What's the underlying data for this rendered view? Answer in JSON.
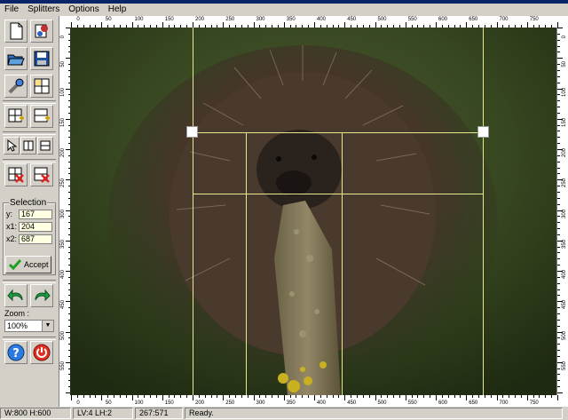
{
  "menu": {
    "file": "File",
    "splitters": "Splitters",
    "options": "Options",
    "help": "Help"
  },
  "selection": {
    "title": "Selection",
    "y_label": "y:",
    "y_value": "167",
    "x1_label": "x1:",
    "x1_value": "204",
    "x2_label": "x2:",
    "x2_value": "687",
    "accept_label": "Accept"
  },
  "zoom": {
    "label": "Zoom :",
    "value": "100%"
  },
  "ruler": {
    "top_marks": [
      "0",
      "50",
      "100",
      "150",
      "200",
      "250",
      "300",
      "350",
      "400",
      "450",
      "500",
      "550",
      "600",
      "650",
      "700",
      "750"
    ],
    "left_marks": [
      "0",
      "50",
      "100",
      "150",
      "200",
      "250",
      "300",
      "350",
      "400",
      "450",
      "500",
      "550"
    ],
    "right_marks": [
      "0",
      "50",
      "100",
      "150",
      "200",
      "250",
      "300",
      "350",
      "400",
      "450",
      "500",
      "550"
    ]
  },
  "status": {
    "dimensions": "W:800 H:600",
    "lines": "LV:4 LH:2",
    "coords": "267:571",
    "message": "Ready."
  },
  "colors": {
    "splitter": "#e8e890",
    "handle": "#ffffff",
    "face": "#d4d0c8"
  }
}
